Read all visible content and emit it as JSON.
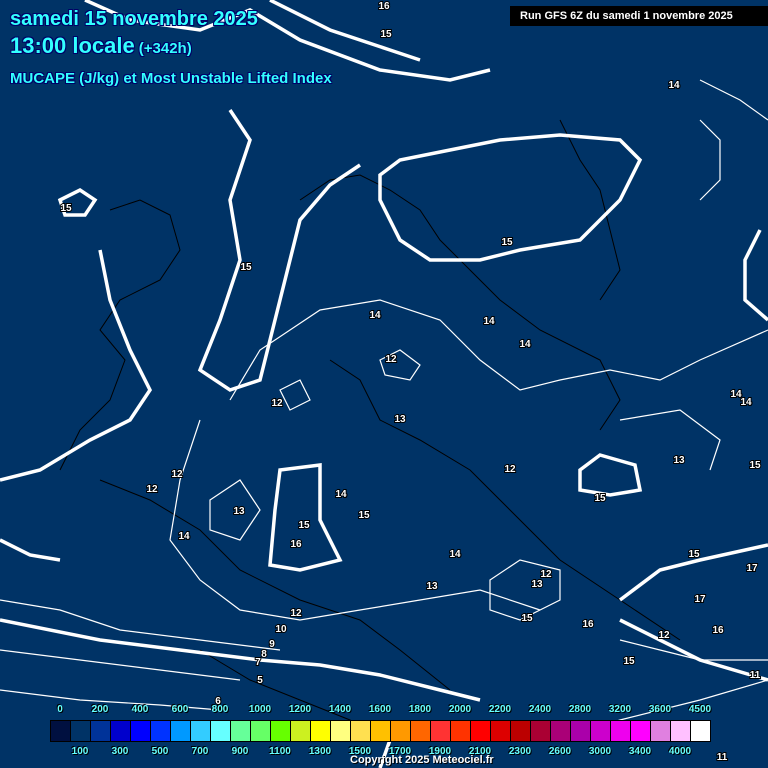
{
  "header": {
    "date": "samedi 15 novembre 2025",
    "time": "13:00 locale",
    "lead": "(+342h)",
    "field": "MUCAPE (J/kg) et Most Unstable Lifted Index",
    "run": "Run GFS 6Z du samedi 1 novembre 2025"
  },
  "colorbar": {
    "labels": [
      "0",
      "100",
      "200",
      "300",
      "400",
      "500",
      "600",
      "700",
      "800",
      "900",
      "1000",
      "1100",
      "1200",
      "1300",
      "1400",
      "1500",
      "1600",
      "1700",
      "1800",
      "1900",
      "2000",
      "2100",
      "2200",
      "2300",
      "2400",
      "2600",
      "2800",
      "3000",
      "3200",
      "3400",
      "3600",
      "4000",
      "4500"
    ],
    "colors": [
      "#001040",
      "#003366",
      "#003399",
      "#0000cc",
      "#0000ff",
      "#0033ff",
      "#0099ff",
      "#33ccff",
      "#66ffff",
      "#66ff99",
      "#66ff66",
      "#66ff00",
      "#ccf020",
      "#ffff00",
      "#ffff80",
      "#ffe050",
      "#ffc000",
      "#ff9900",
      "#ff6600",
      "#ff3333",
      "#ff3300",
      "#ff0000",
      "#dd0000",
      "#bb0000",
      "#aa0033",
      "#aa0077",
      "#aa00aa",
      "#cc00cc",
      "#ee00ee",
      "#ff00ff",
      "#e080e0",
      "#ffc0ff",
      "#ffffff"
    ]
  },
  "contour_labels": [
    "16",
    "15",
    "14",
    "15",
    "15",
    "15",
    "14",
    "14",
    "14",
    "12",
    "12",
    "13",
    "14",
    "14",
    "12",
    "12",
    "13",
    "12",
    "13",
    "15",
    "14",
    "15",
    "15",
    "16",
    "14",
    "14",
    "13",
    "12",
    "13",
    "15",
    "15",
    "15",
    "16",
    "17",
    "17",
    "16",
    "12",
    "15",
    "11",
    "10",
    "9",
    "8",
    "7",
    "5",
    "6",
    "12",
    "12",
    "11"
  ],
  "copyright": "Copyright 2025 Meteociel.fr"
}
